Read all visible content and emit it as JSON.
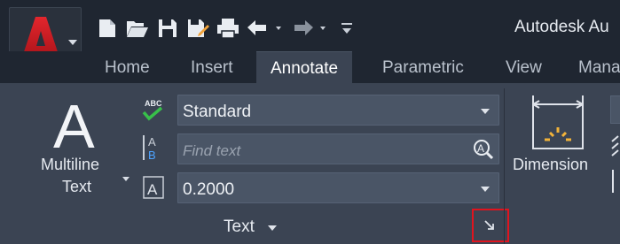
{
  "window": {
    "title": "Autodesk Au"
  },
  "app_menu": {
    "logo_letter": "A",
    "icon": "autocad-logo-icon"
  },
  "quick_access": [
    {
      "name": "new-icon"
    },
    {
      "name": "open-icon"
    },
    {
      "name": "save-icon"
    },
    {
      "name": "save-as-icon"
    },
    {
      "name": "plot-icon"
    },
    {
      "name": "undo-icon"
    },
    {
      "name": "redo-icon"
    },
    {
      "name": "customize-qat-icon"
    }
  ],
  "tabs": [
    {
      "label": "Home",
      "active": false
    },
    {
      "label": "Insert",
      "active": false
    },
    {
      "label": "Annotate",
      "active": true
    },
    {
      "label": "Parametric",
      "active": false
    },
    {
      "label": "View",
      "active": false
    },
    {
      "label": "Mana",
      "active": false
    }
  ],
  "text_panel": {
    "title": "Text",
    "big_icon_letter": "A",
    "multiline_label_line1": "Multiline",
    "multiline_label_line2": "Text",
    "text_style": {
      "value": "Standard"
    },
    "find": {
      "placeholder": "Find text"
    },
    "text_height": {
      "value": "0.2000"
    },
    "spell_check_icon_text": "ABC",
    "launcher_highlight_color": "#e0141e"
  },
  "dimension_panel": {
    "label": "Dimension"
  },
  "colors": {
    "ribbon_bg": "#3b4453",
    "titlebar_bg": "#1f2631",
    "field_bg": "#4a5566",
    "logo_red": "#c8161d"
  }
}
